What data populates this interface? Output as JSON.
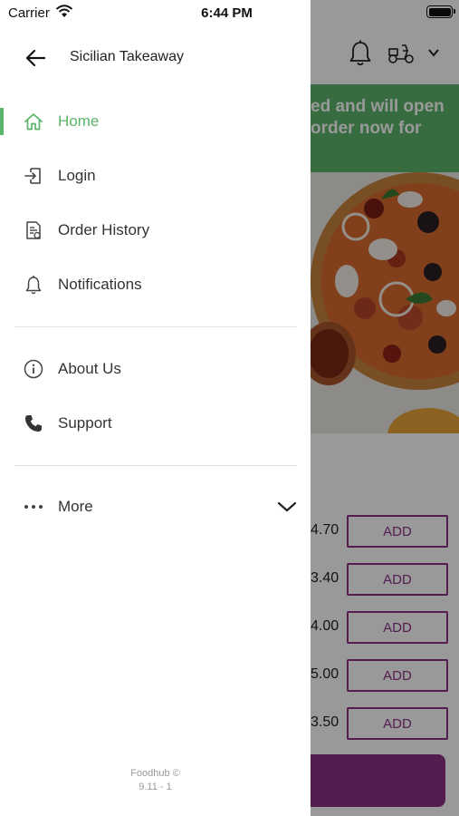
{
  "status_bar": {
    "carrier": "Carrier",
    "time": "6:44 PM"
  },
  "drawer": {
    "title": "Sicilian Takeaway",
    "menu_primary": [
      {
        "label": "Home",
        "icon": "home-icon",
        "active": true
      },
      {
        "label": "Login",
        "icon": "login-icon"
      },
      {
        "label": "Order History",
        "icon": "order-history-icon"
      },
      {
        "label": "Notifications",
        "icon": "bell-icon"
      }
    ],
    "menu_secondary": [
      {
        "label": "About Us",
        "icon": "info-icon"
      },
      {
        "label": "Support",
        "icon": "phone-icon"
      }
    ],
    "more": {
      "label": "More",
      "icon": "more-dots-icon"
    },
    "footer": {
      "brand": "Foodhub ©",
      "version": "9.11 - 1"
    }
  },
  "background": {
    "banner_lines": [
      "ed and will open",
      "order now for"
    ],
    "prices": [
      "4.70",
      "3.40",
      "4.00",
      "5.00",
      "3.50"
    ],
    "add_label": "ADD"
  },
  "colors": {
    "accent_green": "#5bb56a",
    "brand_purple": "#8e2f86",
    "scrim": "rgba(0,0,0,0.40)"
  }
}
